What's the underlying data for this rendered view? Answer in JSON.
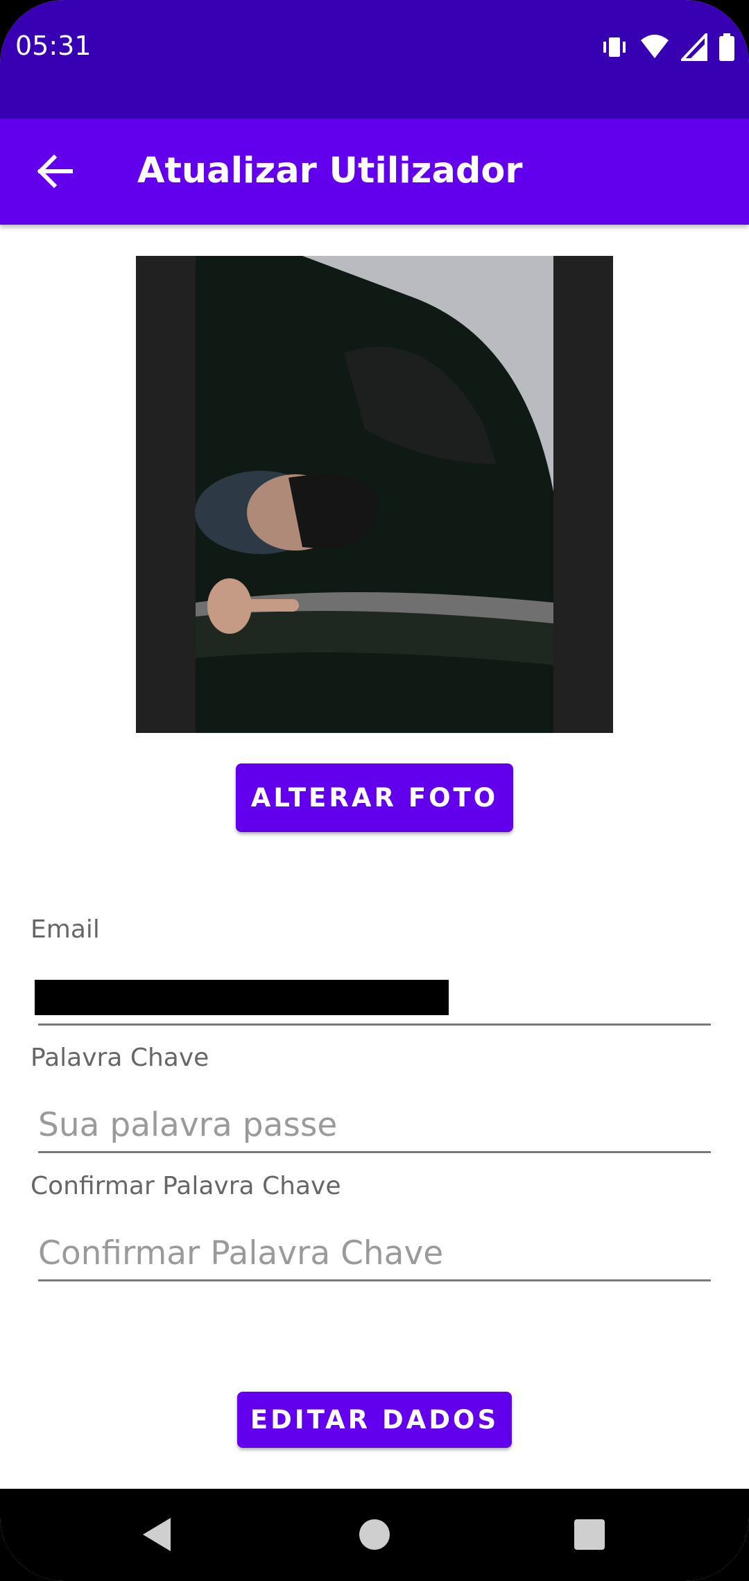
{
  "status_bar": {
    "time": "05:31",
    "icons": [
      "vibrate-icon",
      "wifi-icon",
      "signal-icon",
      "battery-icon"
    ]
  },
  "app_bar": {
    "title": "Atualizar Utilizador",
    "back_icon": "arrow-back-icon"
  },
  "photo": {
    "description_icon": "user-photo"
  },
  "buttons": {
    "change_photo": "ALTERAR FOTO",
    "edit_data": "EDITAR DADOS"
  },
  "form": {
    "email": {
      "label": "Email",
      "value": ""
    },
    "password": {
      "label": "Palavra Chave",
      "placeholder": "Sua palavra passe"
    },
    "confirm_password": {
      "label": "Confirmar Palavra Chave",
      "placeholder": "Confirmar Palavra Chave"
    }
  },
  "nav_bar": {
    "icons": [
      "back-triangle-icon",
      "home-circle-icon",
      "recents-square-icon"
    ]
  },
  "colors": {
    "status_bar": "#3700b3",
    "primary": "#6200ee",
    "background": "#ffffff"
  }
}
